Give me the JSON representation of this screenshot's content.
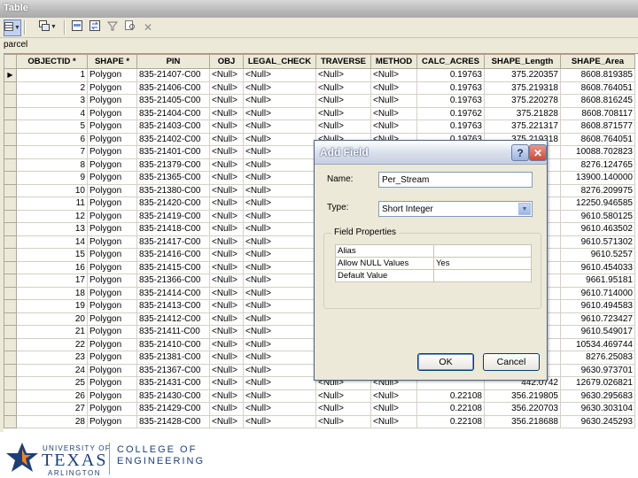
{
  "window": {
    "title": "Table"
  },
  "layer": {
    "name": "parcel"
  },
  "table": {
    "columns": [
      "OBJECTID *",
      "SHAPE *",
      "PIN",
      "OBJ",
      "LEGAL_CHECK",
      "TRAVERSE",
      "METHOD",
      "CALC_ACRES",
      "SHAPE_Length",
      "SHAPE_Area"
    ],
    "rows": [
      [
        "1",
        "Polygon",
        "835-21407-C00",
        "<Null>",
        "<Null>",
        "<Null>",
        "<Null>",
        "0.19763",
        "375.220357",
        "8608.819385"
      ],
      [
        "2",
        "Polygon",
        "835-21406-C00",
        "<Null>",
        "<Null>",
        "<Null>",
        "<Null>",
        "0.19763",
        "375.219318",
        "8608.764051"
      ],
      [
        "3",
        "Polygon",
        "835-21405-C00",
        "<Null>",
        "<Null>",
        "<Null>",
        "<Null>",
        "0.19763",
        "375.220278",
        "8608.816245"
      ],
      [
        "4",
        "Polygon",
        "835-21404-C00",
        "<Null>",
        "<Null>",
        "<Null>",
        "<Null>",
        "0.19762",
        "375.21828",
        "8608.708117"
      ],
      [
        "5",
        "Polygon",
        "835-21403-C00",
        "<Null>",
        "<Null>",
        "<Null>",
        "<Null>",
        "0.19763",
        "375.221317",
        "8608.871577"
      ],
      [
        "6",
        "Polygon",
        "835-21402-C00",
        "<Null>",
        "<Null>",
        "<Null>",
        "<Null>",
        "0.19763",
        "375.219318",
        "8608.764051"
      ],
      [
        "7",
        "Polygon",
        "835-21401-C00",
        "<Null>",
        "<Null>",
        "<Null>",
        "<Null>",
        "",
        "",
        "10088.702823"
      ],
      [
        "8",
        "Polygon",
        "835-21379-C00",
        "<Null>",
        "<Null>",
        "<Null>",
        "<Null>",
        "",
        "",
        "8276.124765"
      ],
      [
        "9",
        "Polygon",
        "835-21365-C00",
        "<Null>",
        "<Null>",
        "<Null>",
        "<Null>",
        "",
        "",
        "13900.140000"
      ],
      [
        "10",
        "Polygon",
        "835-21380-C00",
        "<Null>",
        "<Null>",
        "<Null>",
        "<Null>",
        "",
        "",
        "8276.209975"
      ],
      [
        "11",
        "Polygon",
        "835-21420-C00",
        "<Null>",
        "<Null>",
        "<Null>",
        "<Null>",
        "",
        "",
        "12250.946585"
      ],
      [
        "12",
        "Polygon",
        "835-21419-C00",
        "<Null>",
        "<Null>",
        "<Null>",
        "<Null>",
        "",
        "",
        "9610.580125"
      ],
      [
        "13",
        "Polygon",
        "835-21418-C00",
        "<Null>",
        "<Null>",
        "<Null>",
        "<Null>",
        "",
        "",
        "9610.463502"
      ],
      [
        "14",
        "Polygon",
        "835-21417-C00",
        "<Null>",
        "<Null>",
        "<Null>",
        "<Null>",
        "",
        "",
        "9610.571302"
      ],
      [
        "15",
        "Polygon",
        "835-21416-C00",
        "<Null>",
        "<Null>",
        "<Null>",
        "<Null>",
        "",
        "",
        "9610.5257"
      ],
      [
        "16",
        "Polygon",
        "835-21415-C00",
        "<Null>",
        "<Null>",
        "<Null>",
        "<Null>",
        "",
        "",
        "9610.454033"
      ],
      [
        "17",
        "Polygon",
        "835-21366-C00",
        "<Null>",
        "<Null>",
        "<Null>",
        "<Null>",
        "",
        "",
        "9661.95181"
      ],
      [
        "18",
        "Polygon",
        "835-21414-C00",
        "<Null>",
        "<Null>",
        "<Null>",
        "<Null>",
        "",
        "",
        "9610.714000"
      ],
      [
        "19",
        "Polygon",
        "835-21413-C00",
        "<Null>",
        "<Null>",
        "<Null>",
        "<Null>",
        "",
        "",
        "9610.494583"
      ],
      [
        "20",
        "Polygon",
        "835-21412-C00",
        "<Null>",
        "<Null>",
        "<Null>",
        "<Null>",
        "",
        "",
        "9610.723427"
      ],
      [
        "21",
        "Polygon",
        "835-21411-C00",
        "<Null>",
        "<Null>",
        "<Null>",
        "<Null>",
        "",
        "",
        "9610.549017"
      ],
      [
        "22",
        "Polygon",
        "835-21410-C00",
        "<Null>",
        "<Null>",
        "<Null>",
        "<Null>",
        "",
        "",
        "10534.469744"
      ],
      [
        "23",
        "Polygon",
        "835-21381-C00",
        "<Null>",
        "<Null>",
        "<Null>",
        "<Null>",
        "",
        "",
        "8276.25083"
      ],
      [
        "24",
        "Polygon",
        "835-21367-C00",
        "<Null>",
        "<Null>",
        "<Null>",
        "<Null>",
        "",
        "",
        "9630.973701"
      ],
      [
        "25",
        "Polygon",
        "835-21431-C00",
        "<Null>",
        "<Null>",
        "<Null>",
        "<Null>",
        "",
        "442.0742",
        "12679.026821"
      ],
      [
        "26",
        "Polygon",
        "835-21430-C00",
        "<Null>",
        "<Null>",
        "<Null>",
        "<Null>",
        "0.22108",
        "356.219805",
        "9630.295683"
      ],
      [
        "27",
        "Polygon",
        "835-21429-C00",
        "<Null>",
        "<Null>",
        "<Null>",
        "<Null>",
        "0.22108",
        "356.220703",
        "9630.303104"
      ],
      [
        "28",
        "Polygon",
        "835-21428-C00",
        "<Null>",
        "<Null>",
        "<Null>",
        "<Null>",
        "0.22108",
        "356.218688",
        "9630.245293"
      ]
    ]
  },
  "dialog": {
    "title": "Add Field",
    "name_label": "Name:",
    "name_value": "Per_Stream",
    "type_label": "Type:",
    "type_value": "Short Integer",
    "group_title": "Field Properties",
    "properties": [
      [
        "Alias",
        ""
      ],
      [
        "Allow NULL Values",
        "Yes"
      ],
      [
        "Default Value",
        ""
      ]
    ],
    "ok_label": "OK",
    "cancel_label": "Cancel",
    "help_glyph": "?",
    "close_glyph": "✕"
  },
  "footer": {
    "univ_line1": "UNIVERSITY OF",
    "univ_line2": "TEXAS",
    "univ_line3": "ARLINGTON",
    "college_line1": "COLLEGE OF",
    "college_line2": "ENGINEERING",
    "accent_color": "#f58025",
    "brand_color": "#1d3f77"
  },
  "icons": [
    "table-options-icon",
    "related-tables-icon",
    "select-by-attributes-icon",
    "switch-selection-icon",
    "clear-selection-icon",
    "zoom-to-selected-icon",
    "delete-selected-icon",
    "row-selector-arrow-icon",
    "dropdown-arrow-icon",
    "ut-star-logo-icon"
  ]
}
